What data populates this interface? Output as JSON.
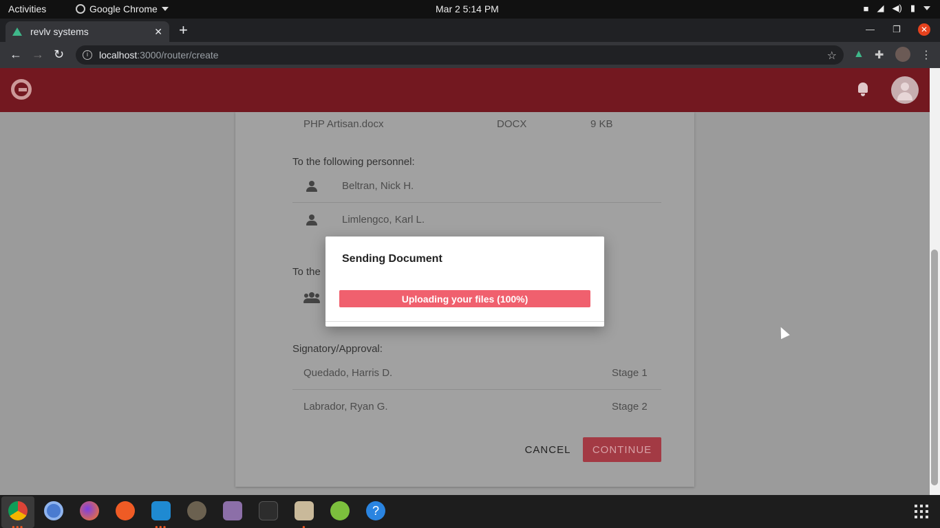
{
  "system_bar": {
    "activities": "Activities",
    "app_menu": "Google Chrome",
    "clock": "Mar 2   5:14 PM"
  },
  "browser": {
    "tab_title": "revlv systems",
    "url_host": "localhost",
    "url_path": ":3000/router/create"
  },
  "app": {
    "file": {
      "name": "PHP Artisan.docx",
      "type": "DOCX",
      "size": "9 KB"
    },
    "personnel_heading": "To the following personnel:",
    "personnel": [
      "Beltran, Nick H.",
      "Limlengco, Karl L."
    ],
    "groups_heading_partial": "To the",
    "signatory_heading": "Signatory/Approval:",
    "signatories": [
      {
        "name": "Quedado, Harris D.",
        "stage": "Stage 1"
      },
      {
        "name": "Labrador, Ryan G.",
        "stage": "Stage 2"
      }
    ],
    "cancel_label": "CANCEL",
    "continue_label": "CONTINUE"
  },
  "dialog": {
    "title": "Sending Document",
    "progress_text": "Uploading your files (100%)",
    "progress_value": 1.0,
    "progress_color": "#f0606e"
  },
  "colors": {
    "header": "#731820",
    "brand_accent": "#a33a44"
  },
  "dock": {
    "apps": [
      "chrome-icon",
      "chromium-icon",
      "firefox-icon",
      "postman-icon",
      "vscode-icon",
      "gimp-icon",
      "video-icon",
      "terminal-icon",
      "files-icon",
      "android-studio-icon",
      "help-icon"
    ]
  }
}
